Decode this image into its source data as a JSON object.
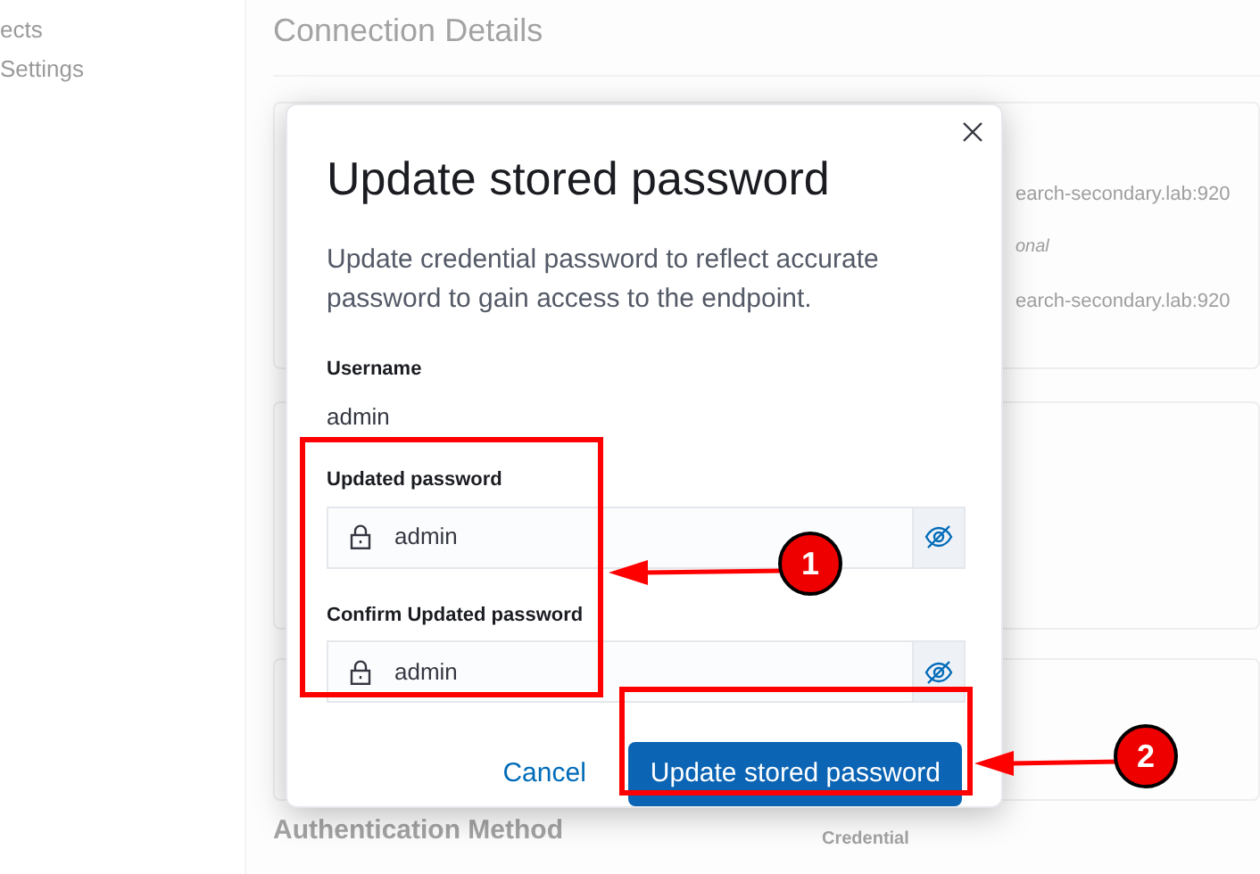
{
  "sidebar": {
    "items": [
      "ects",
      "Settings"
    ]
  },
  "background": {
    "heading": "Connection Details",
    "host_1": "earch-secondary.lab:920",
    "optional": "onal",
    "host_2": "earch-secondary.lab:920",
    "auth_heading": "Authentication Method",
    "credential_label": "Credential"
  },
  "modal": {
    "title": "Update stored password",
    "description": "Update credential password to reflect accurate password to gain access to the endpoint.",
    "username_label": "Username",
    "username": "admin",
    "fields": [
      {
        "label": "Updated password",
        "value": "admin"
      },
      {
        "label": "Confirm Updated password",
        "value": "admin"
      }
    ],
    "cancel": "Cancel",
    "submit": "Update stored password"
  },
  "callouts": [
    "1",
    "2"
  ]
}
